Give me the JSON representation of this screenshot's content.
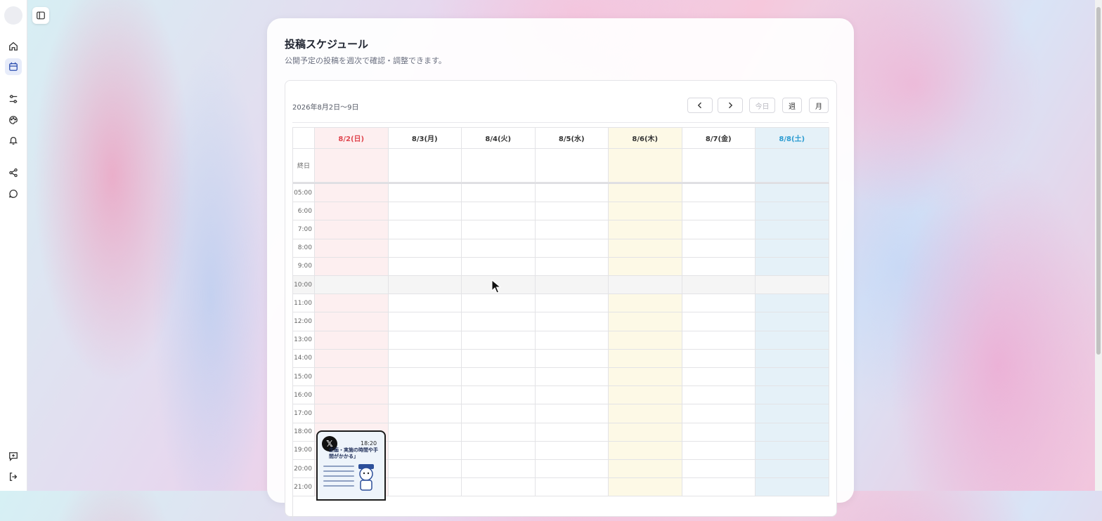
{
  "schedule": {
    "title": "投稿スケジュール",
    "subtitle": "公開予定の投稿を週次で確認・調整できます。"
  },
  "toolbar": {
    "range_label": "2026年8月2日〜9日",
    "today_label": "今日",
    "week_label": "週",
    "month_label": "月"
  },
  "calendar": {
    "days": [
      {
        "label": "8/2(日)",
        "kind": "sunday"
      },
      {
        "label": "8/3(月)",
        "kind": "weekday"
      },
      {
        "label": "8/4(火)",
        "kind": "weekday"
      },
      {
        "label": "8/5(水)",
        "kind": "weekday"
      },
      {
        "label": "8/6(木)",
        "kind": "today"
      },
      {
        "label": "8/7(金)",
        "kind": "weekday"
      },
      {
        "label": "8/8(土)",
        "kind": "saturday"
      }
    ],
    "allday_label": "終日",
    "times": [
      "05:00",
      "6:00",
      "7:00",
      "8:00",
      "9:00",
      "10:00",
      "11:00",
      "12:00",
      "13:00",
      "14:00",
      "15:00",
      "16:00",
      "17:00",
      "18:00",
      "19:00",
      "20:00",
      "21:00"
    ],
    "highlight_time": "10:00"
  },
  "event": {
    "platform_icon": "x-logo-icon",
    "time": "18:20",
    "heading": "企画・実施の時間や手間がかかる」"
  },
  "colors": {
    "sunday": "#e0464f",
    "saturday": "#2a9bd1",
    "active_nav": "#2d4fb0"
  },
  "sidebar": {
    "icons": [
      "home-icon",
      "calendar-icon",
      "sliders-icon",
      "palette-icon",
      "bell-icon",
      "share-icon",
      "chat-icon",
      "feedback-icon",
      "logout-icon"
    ]
  }
}
